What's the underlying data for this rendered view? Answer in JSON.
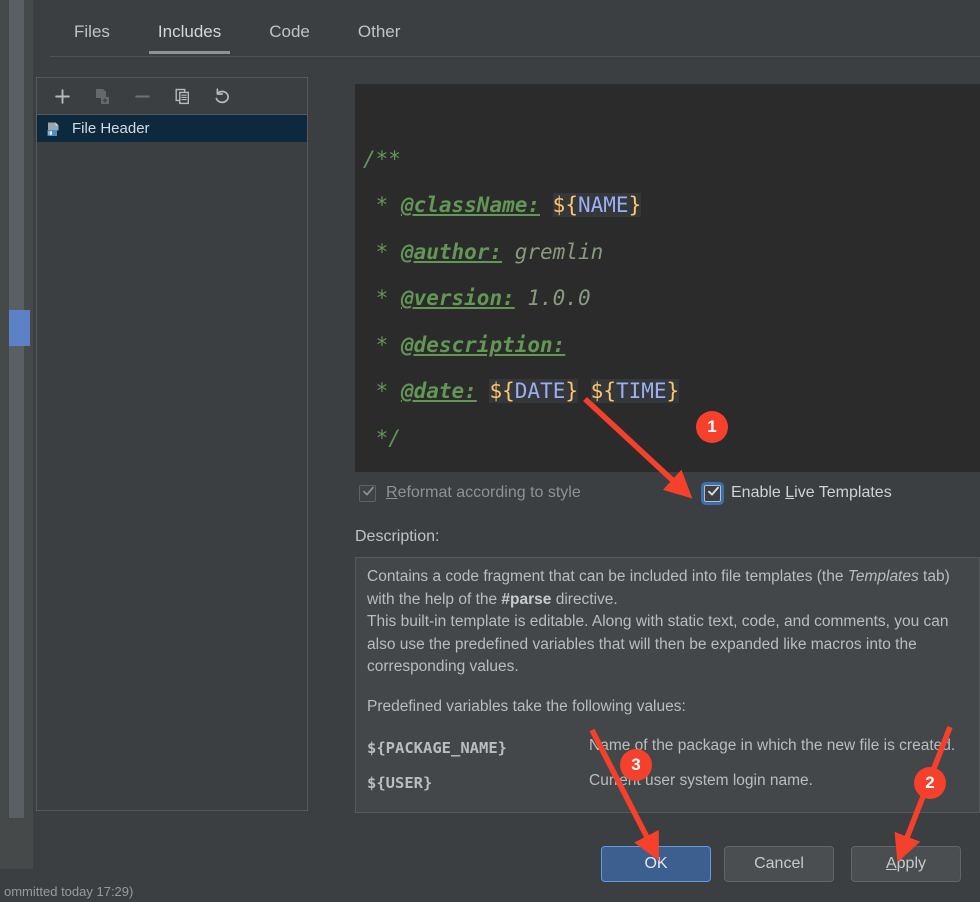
{
  "dialog": {
    "tabs": [
      {
        "label": "Files",
        "active": false
      },
      {
        "label": "Includes",
        "active": true
      },
      {
        "label": "Code",
        "active": false
      },
      {
        "label": "Other",
        "active": false
      }
    ],
    "list_toolbar": [
      {
        "name": "add-icon",
        "label": "+",
        "disabled": false
      },
      {
        "name": "copy-template-icon",
        "label": "Copy Template",
        "disabled": true
      },
      {
        "name": "remove-icon",
        "label": "−",
        "disabled": true
      },
      {
        "name": "duplicate-icon",
        "label": "Duplicate",
        "disabled": false
      },
      {
        "name": "reset-icon",
        "label": "Reset",
        "disabled": false
      }
    ],
    "list_items": [
      {
        "label": "File Header",
        "selected": true
      }
    ],
    "editor": {
      "lines": [
        {
          "tokens": [
            {
              "t": "comment",
              "v": "/**"
            }
          ]
        },
        {
          "tokens": [
            {
              "t": "comment",
              "v": " * "
            },
            {
              "t": "tag",
              "v": "@className:"
            },
            {
              "t": "comment",
              "v": " "
            },
            {
              "t": "macro",
              "v": "${NAME}"
            }
          ]
        },
        {
          "tokens": [
            {
              "t": "comment",
              "v": " * "
            },
            {
              "t": "tag",
              "v": "@author:"
            },
            {
              "t": "text",
              "v": " gremlin"
            }
          ]
        },
        {
          "tokens": [
            {
              "t": "comment",
              "v": " * "
            },
            {
              "t": "tag",
              "v": "@version:"
            },
            {
              "t": "text",
              "v": " 1.0.0"
            }
          ]
        },
        {
          "tokens": [
            {
              "t": "comment",
              "v": " * "
            },
            {
              "t": "tag",
              "v": "@description:"
            }
          ]
        },
        {
          "tokens": [
            {
              "t": "comment",
              "v": " * "
            },
            {
              "t": "tag",
              "v": "@date:"
            },
            {
              "t": "comment",
              "v": " "
            },
            {
              "t": "macro",
              "v": "${DATE}"
            },
            {
              "t": "comment",
              "v": " "
            },
            {
              "t": "macro",
              "v": "${TIME}"
            }
          ]
        },
        {
          "tokens": [
            {
              "t": "comment",
              "v": " */"
            }
          ]
        }
      ]
    },
    "checkboxes": {
      "reformat": {
        "label_pre": "",
        "label_underline": "R",
        "label_post": "eformat according to style",
        "checked": true,
        "enabled": false
      },
      "live_templates": {
        "label_pre": "Enable ",
        "label_underline": "L",
        "label_post": "ive Templates",
        "checked": true,
        "enabled": true,
        "focused": true
      }
    },
    "description_label": "Description:",
    "description": {
      "paragraph1_a": "Contains a code fragment that can be included into file templates (the ",
      "paragraph1_italic": "Templates",
      "paragraph1_b": " tab) with the help of the ",
      "paragraph1_bold": "#parse",
      "paragraph1_c": " directive.",
      "paragraph2": "This built-in template is editable. Along with static text, code, and comments, you can also use the predefined variables that will then be expanded like macros into the corresponding values.",
      "paragraph3": "Predefined variables take the following values:",
      "variables": [
        {
          "name": "${PACKAGE_NAME}",
          "desc": "Name of the package in which the new file is created."
        },
        {
          "name": "${USER}",
          "desc": "Current user system login name."
        }
      ]
    },
    "buttons": {
      "ok": "OK",
      "cancel": "Cancel",
      "apply_pre": "",
      "apply_underline": "A",
      "apply_post": "pply"
    }
  },
  "annotations": [
    {
      "id": "1",
      "label": "1",
      "target": "enable-live-templates-checkbox"
    },
    {
      "id": "2",
      "label": "2",
      "target": "apply-button"
    },
    {
      "id": "3",
      "label": "3",
      "target": "ok-button"
    }
  ],
  "ide": {
    "statusbar_text": "ommitted today 17:29)",
    "statusbar_right": ""
  },
  "colors": {
    "accent_blue": "#3c6eb4",
    "annotation_red": "#f5402c",
    "selection_blue": "#0d293e",
    "editor_bg": "#2b2b2b",
    "dialog_bg": "#3c3f41",
    "comment_green": "#629755",
    "macro_orange": "#ffc66d",
    "macro_var_blue": "#9daef3"
  }
}
